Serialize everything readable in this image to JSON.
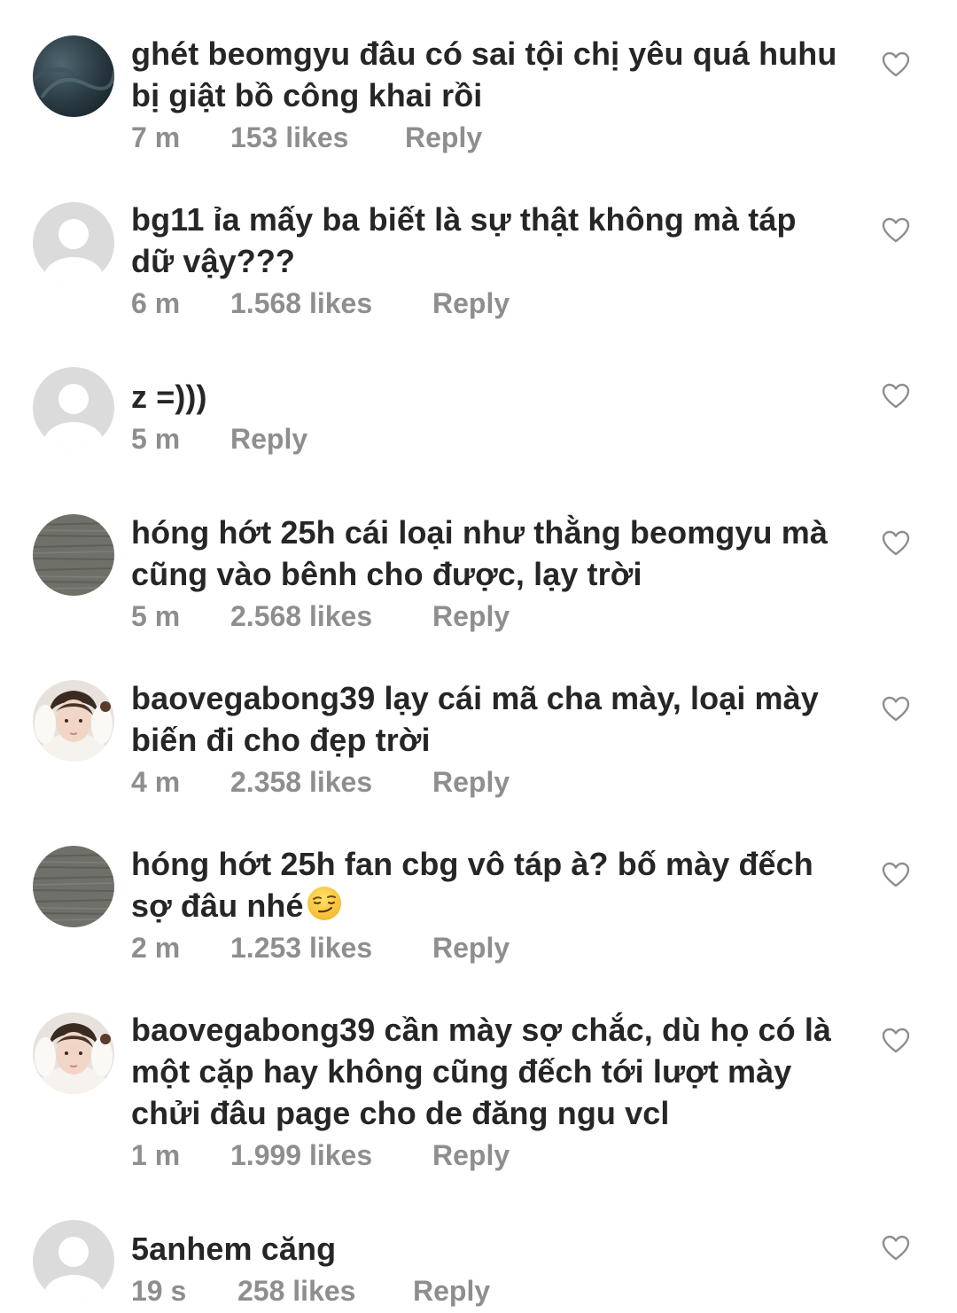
{
  "comments": [
    {
      "username": "ghét beomgyu",
      "text": "đâu có sai tội chị yêu quá huhu bị giật bồ công khai rồi",
      "time": "7 m",
      "likes": "153 likes",
      "reply": "Reply",
      "avatar": "dark-blue-texture"
    },
    {
      "username": "bg11",
      "text": "ỉa mấy ba biết là sự thật không mà táp dữ vậy???",
      "time": "6 m",
      "likes": "1.568 likes",
      "reply": "Reply",
      "avatar": "default-gray"
    },
    {
      "username": "z",
      "text": "=)))",
      "time": "5 m",
      "likes": "",
      "reply": "Reply",
      "avatar": "default-gray"
    },
    {
      "username": "hóng hớt 25h",
      "text": "cái loại như thằng beomgyu mà cũng vào bênh cho được, lạy trời",
      "time": "5 m",
      "likes": "2.568 likes",
      "reply": "Reply",
      "avatar": "gray-sea"
    },
    {
      "username": "baovegabong39",
      "text": "lạy cái mã cha mày, loại mày biến đi cho đẹp trời",
      "time": "4 m",
      "likes": "2.358 likes",
      "reply": "Reply",
      "avatar": "person-photo"
    },
    {
      "username": "hóng hớt 25h",
      "text": "fan cbg vô táp à? bố mày đếch sợ đâu nhé",
      "emoji": "smirking-face-emoji",
      "time": "2 m",
      "likes": "1.253 likes",
      "reply": "Reply",
      "avatar": "gray-sea"
    },
    {
      "username": "baovegabong39",
      "text": "cần mày sợ chắc, dù họ có là một cặp hay không cũng đếch tới lượt mày chửi đâu page cho de đăng ngu vcl",
      "time": "1 m",
      "likes": "1.999 likes",
      "reply": "Reply",
      "avatar": "person-photo"
    },
    {
      "username": "5anhem",
      "text": "căng",
      "time": "19 s",
      "likes": "258 likes",
      "reply": "Reply",
      "avatar": "default-gray"
    }
  ],
  "colors": {
    "text": "#262626",
    "meta": "#8e8e8e",
    "avatar_placeholder": "#dbdbdb"
  },
  "icons": {
    "like": "heart-outline-icon"
  }
}
